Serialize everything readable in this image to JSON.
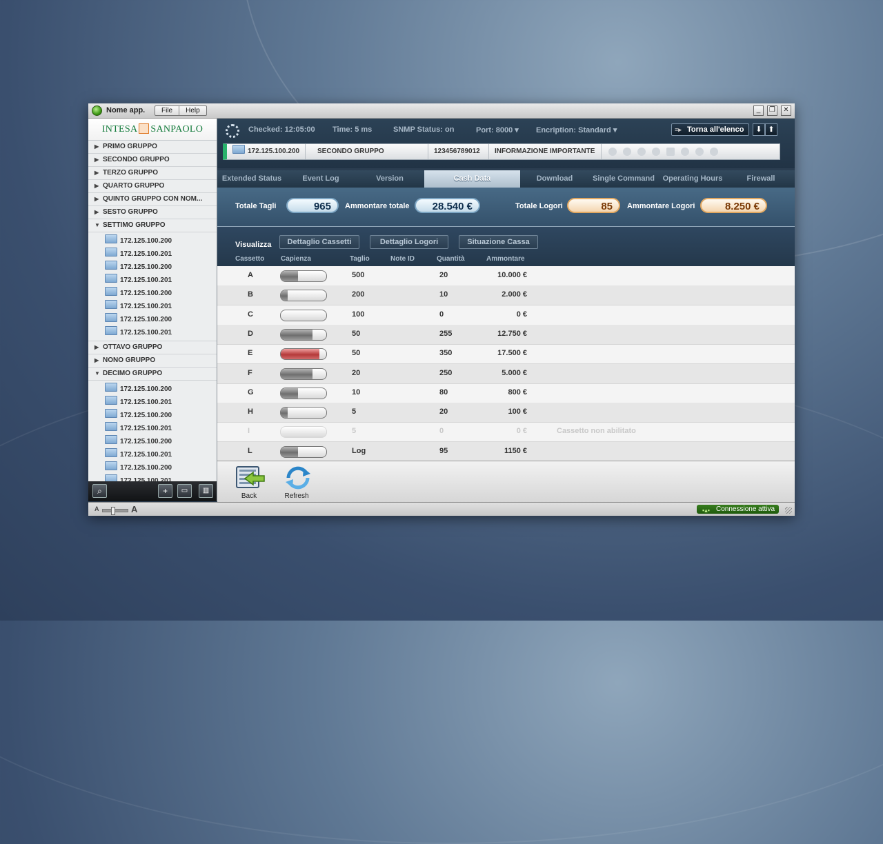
{
  "app": {
    "name": "Nome app.",
    "menu": [
      "File",
      "Help"
    ]
  },
  "window_controls": {
    "minimize": "_",
    "restore": "❐",
    "close": "✕"
  },
  "sidebar": {
    "logo_left": "INTESA",
    "logo_right": "SANPAOLO",
    "groups_top": [
      {
        "label": "PRIMO GRUPPO",
        "expanded": false
      },
      {
        "label": "SECONDO GRUPPO",
        "expanded": false
      },
      {
        "label": "TERZO GRUPPO",
        "expanded": false
      },
      {
        "label": "QUARTO GRUPPO",
        "expanded": false
      },
      {
        "label": "QUINTO GRUPPO CON NOM...",
        "expanded": false
      },
      {
        "label": "SESTO GRUPPO",
        "expanded": false
      },
      {
        "label": "SETTIMO GRUPPO",
        "expanded": true
      }
    ],
    "settimo_items": [
      "172.125.100.200",
      "172.125.100.201",
      "172.125.100.200",
      "172.125.100.201",
      "172.125.100.200",
      "172.125.100.201",
      "172.125.100.200",
      "172.125.100.201"
    ],
    "groups_mid": [
      {
        "label": "OTTAVO GRUPPO",
        "expanded": false
      },
      {
        "label": "NONO GRUPPO",
        "expanded": false
      },
      {
        "label": "DECIMO GRUPPO",
        "expanded": true
      }
    ],
    "decimo_items": [
      "172.125.100.200",
      "172.125.100.201",
      "172.125.100.200",
      "172.125.100.201",
      "172.125.100.200",
      "172.125.100.201",
      "172.125.100.200",
      "172.125.100.201"
    ]
  },
  "status": {
    "checked": "Checked: 12:05:00",
    "time": "Time: 5 ms",
    "snmp": "SNMP Status: on",
    "port": "Port: 8000 ▾",
    "encription": "Encription: Standard ▾",
    "back_to_list": "Torna all'elenco"
  },
  "info": {
    "ip": "172.125.100.200",
    "group": "SECONDO GRUPPO",
    "serial": "123456789012",
    "message": "INFORMAZIONE IMPORTANTE"
  },
  "tabs": [
    {
      "label": "Extended Status",
      "active": false
    },
    {
      "label": "Event Log",
      "active": false
    },
    {
      "label": "Version",
      "active": false
    },
    {
      "label": "Cash Data",
      "active": true
    },
    {
      "label": "Download",
      "active": false
    },
    {
      "label": "Single Command",
      "active": false
    },
    {
      "label": "Operating Hours",
      "active": false
    },
    {
      "label": "Firewall",
      "active": false
    }
  ],
  "totals": {
    "totale_tagli_label": "Totale Tagli",
    "totale_tagli": "965",
    "ammontare_totale_label": "Ammontare totale",
    "ammontare_totale": "28.540 €",
    "totale_logori_label": "Totale Logori",
    "totale_logori": "85",
    "ammontare_logori_label": "Ammontare Logori",
    "ammontare_logori": "8.250 €"
  },
  "view": {
    "label": "Visualizza",
    "buttons": [
      {
        "label": "Dettaglio Cassetti",
        "active": true
      },
      {
        "label": "Dettaglio Logori",
        "active": false
      },
      {
        "label": "Situazione Cassa",
        "active": false
      }
    ]
  },
  "columns": [
    "Cassetto",
    "Capienza",
    "Taglio",
    "Note ID",
    "Quantità",
    "Ammontare"
  ],
  "rows": [
    {
      "cassetto": "A",
      "capienza": 0.38,
      "taglio": "500",
      "note_id": "",
      "quantita": "20",
      "ammontare": "10.000 €",
      "note": "",
      "enabled": true,
      "alert": false
    },
    {
      "cassetto": "B",
      "capienza": 0.15,
      "taglio": "200",
      "note_id": "",
      "quantita": "10",
      "ammontare": "2.000 €",
      "note": "",
      "enabled": true,
      "alert": false
    },
    {
      "cassetto": "C",
      "capienza": 0.0,
      "taglio": "100",
      "note_id": "",
      "quantita": "0",
      "ammontare": "0 €",
      "note": "",
      "enabled": true,
      "alert": false
    },
    {
      "cassetto": "D",
      "capienza": 0.7,
      "taglio": "50",
      "note_id": "",
      "quantita": "255",
      "ammontare": "12.750 €",
      "note": "",
      "enabled": true,
      "alert": false
    },
    {
      "cassetto": "E",
      "capienza": 0.85,
      "taglio": "50",
      "note_id": "",
      "quantita": "350",
      "ammontare": "17.500 €",
      "note": "",
      "enabled": true,
      "alert": true
    },
    {
      "cassetto": "F",
      "capienza": 0.7,
      "taglio": "20",
      "note_id": "",
      "quantita": "250",
      "ammontare": "5.000 €",
      "note": "",
      "enabled": true,
      "alert": false
    },
    {
      "cassetto": "G",
      "capienza": 0.38,
      "taglio": "10",
      "note_id": "",
      "quantita": "80",
      "ammontare": "800 €",
      "note": "",
      "enabled": true,
      "alert": false
    },
    {
      "cassetto": "H",
      "capienza": 0.15,
      "taglio": "5",
      "note_id": "",
      "quantita": "20",
      "ammontare": "100 €",
      "note": "",
      "enabled": true,
      "alert": false
    },
    {
      "cassetto": "I",
      "capienza": 0.0,
      "taglio": "5",
      "note_id": "",
      "quantita": "0",
      "ammontare": "0 €",
      "note": "Cassetto non abilitato",
      "enabled": false,
      "alert": false
    },
    {
      "cassetto": "L",
      "capienza": 0.38,
      "taglio": "Log",
      "note_id": "",
      "quantita": "95",
      "ammontare": "1150 €",
      "note": "",
      "enabled": true,
      "alert": false
    }
  ],
  "actions": {
    "back": "Back",
    "refresh": "Refresh"
  },
  "footer": {
    "font_small": "A",
    "font_large": "A",
    "connection": "Connessione attiva"
  }
}
